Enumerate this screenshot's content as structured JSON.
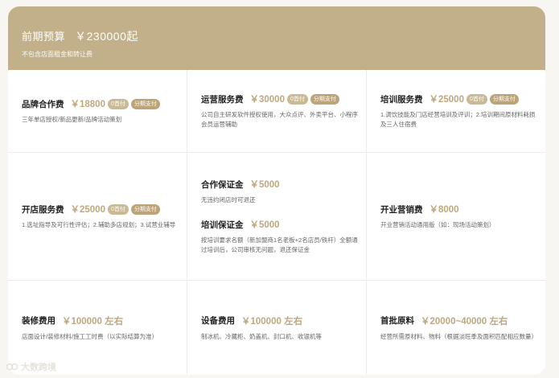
{
  "header": {
    "title": "前期预算",
    "price": "￥230000起",
    "subtitle": "不包含店面租金和转让费"
  },
  "cells": [
    {
      "name": "品牌合作费",
      "amount": "￥18800",
      "badge_zero": "0首付",
      "badge_install": "分期支付",
      "desc": "三年单店授权/新品更新/品牌活动策划"
    },
    {
      "name": "运营服务费",
      "amount": "￥30000",
      "badge_zero": "0首付",
      "badge_install": "分期支付",
      "desc": "公司自主研发软件授权使用，大众点评、外卖平台、小程序会员运营辅助"
    },
    {
      "name": "培训服务费",
      "amount": "￥25000",
      "badge_zero": "0首付",
      "badge_install": "分期支付",
      "desc": "1.调饮技能及门店经营培训及评训；2.培训期间原材料耗损及三人住宿费"
    },
    {
      "name": "开店服务费",
      "amount": "￥25000",
      "badge_zero": "0首付",
      "badge_install": "分期支付",
      "desc": "1.选址指导及可行性评估；2.辅助多店规划；3.试营业辅导"
    },
    {
      "name": "合作保证金",
      "amount": "￥5000",
      "desc": "无违约闭店时可退还"
    },
    {
      "name": "培训保证金",
      "amount": "￥5000",
      "desc": "按培训要求名额（新加盟商1名老板+2名店员/铁杆）全额通过培训后，公司审核无问题，退还保证金"
    },
    {
      "name": "开业营销费",
      "amount": "￥8000",
      "desc": "开业营销活动通用版（如：现场活动策划）"
    },
    {
      "name": "装修费用",
      "amount": "￥100000 左右",
      "desc": "店面设计/装修材料/施工工时费（以实际结算为准）"
    },
    {
      "name": "设备费用",
      "amount": "￥100000 左右",
      "desc": "制冰机、冷藏柜、奶盖机、封口机、收银机等"
    },
    {
      "name": "首批原料",
      "amount": "￥20000~40000 左右",
      "desc": "经营所需原材料、物料（根据淡旺季及面积匹配相应数量）"
    }
  ],
  "watermark": "大数跨境"
}
